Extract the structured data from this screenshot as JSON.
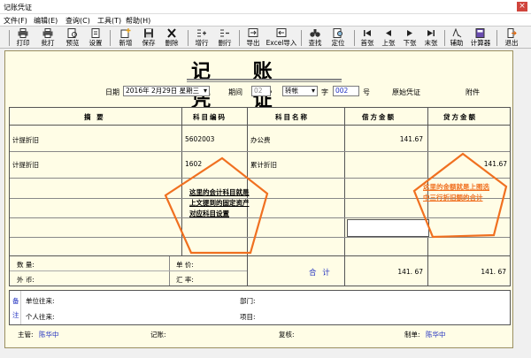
{
  "window": {
    "title": "记账凭证",
    "close_glyph": "×"
  },
  "menu": [
    "文件(F)",
    "编辑(E)",
    "查询(C)",
    "工具(T)",
    "帮助(H)"
  ],
  "toolbar": [
    {
      "label": "打印",
      "icon": "printer-icon"
    },
    {
      "label": "批打",
      "icon": "batch-print-icon"
    },
    {
      "label": "预览",
      "icon": "preview-icon"
    },
    {
      "label": "设置",
      "icon": "page-setup-icon"
    },
    {
      "label": "新增",
      "icon": "add-icon"
    },
    {
      "label": "保存",
      "icon": "save-icon"
    },
    {
      "label": "删除",
      "icon": "delete-icon"
    },
    {
      "label": "增行",
      "icon": "insert-row-icon"
    },
    {
      "label": "删行",
      "icon": "delete-row-icon"
    },
    {
      "label": "导出",
      "icon": "export-icon"
    },
    {
      "label": "Excel导入",
      "icon": "excel-import-icon"
    },
    {
      "label": "查找",
      "icon": "binoculars-icon"
    },
    {
      "label": "定位",
      "icon": "locate-icon"
    },
    {
      "label": "首张",
      "icon": "first-icon"
    },
    {
      "label": "上张",
      "icon": "prev-icon"
    },
    {
      "label": "下张",
      "icon": "next-icon"
    },
    {
      "label": "末张",
      "icon": "last-icon"
    },
    {
      "label": "辅助",
      "icon": "assist-icon"
    },
    {
      "label": "计算器",
      "icon": "calculator-icon"
    },
    {
      "label": "退出",
      "icon": "exit-icon"
    }
  ],
  "voucher": {
    "title": "记 账 凭 证",
    "date_label": "日期",
    "date_value": "2016年 2月29日 星期三",
    "period_label": "期间",
    "period_value": "02",
    "type_value": "转帐",
    "number_label": "字",
    "number_value": "002",
    "number_suffix": "号",
    "original_label": "原始凭证",
    "attach_label": "附件"
  },
  "table": {
    "headers": [
      "摘    要",
      "科目编码",
      "科目名称",
      "借方金额",
      "贷方金额"
    ],
    "rows": [
      {
        "summary": "计提折旧",
        "code": "5602003",
        "name": "办公费",
        "debit": "141.67",
        "credit": ""
      },
      {
        "summary": "计提折旧",
        "code": "1602",
        "name": "累计折旧",
        "debit": "",
        "credit": "141.67"
      }
    ]
  },
  "totals": {
    "qty_label": "数  量:",
    "price_label": "单  价:",
    "currency_label": "外  币:",
    "rate_label": "汇  率:",
    "sum_label": "合  计",
    "debit": "141. 67",
    "credit": "141. 67"
  },
  "notes": {
    "side_top": "备",
    "side_bottom": "注",
    "unit_label": "单位往来:",
    "dept_label": "部门:",
    "person_label": "个人往来:",
    "project_label": "项目:"
  },
  "footer": {
    "supervisor_label": "主管:",
    "supervisor_name": "陈华中",
    "bookkeeper_label": "记账:",
    "reviewer_label": "复核:",
    "maker_label": "制单:",
    "maker_name": "陈华中"
  },
  "annotations": {
    "left_lines": [
      "这里的会计科目就是",
      "上文提到的固定资产",
      "对应科目设置"
    ],
    "right_lines": [
      "这里的金额就是上图选",
      "中三行折旧额的合计"
    ],
    "left_color": "#000000",
    "right_color": "#f07020",
    "pentagon_color": "#f07020"
  }
}
